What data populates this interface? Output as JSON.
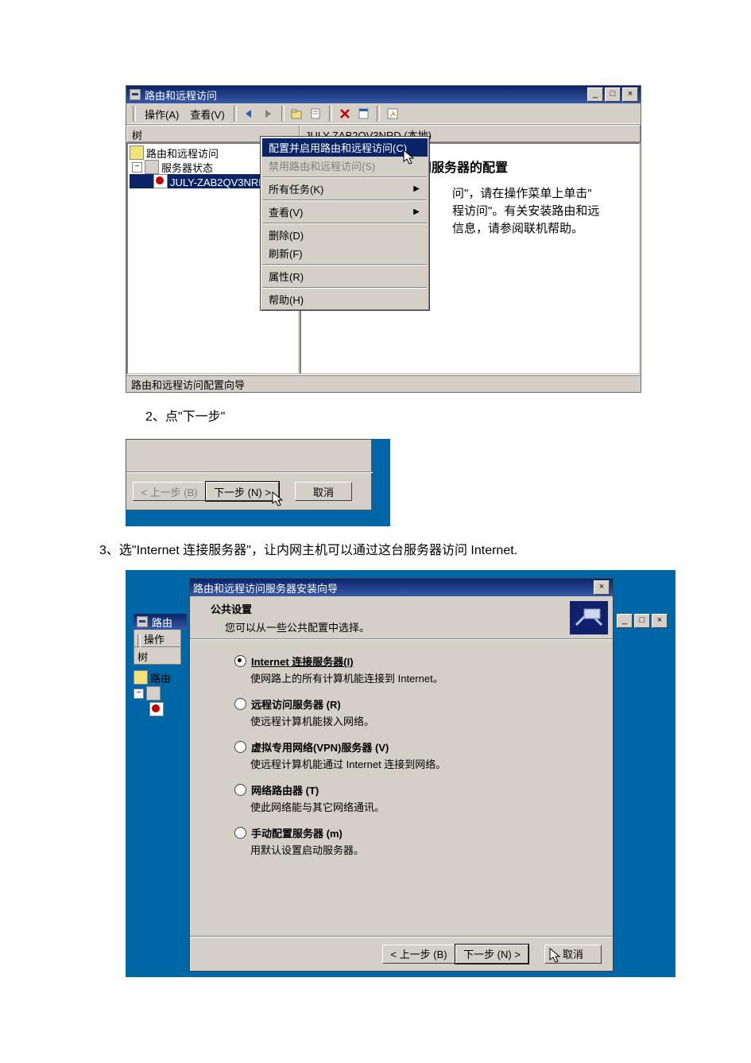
{
  "shot1": {
    "title": "路由和远程访问",
    "menu": {
      "action": "操作(A)",
      "view": "查看(V)"
    },
    "heads": {
      "tree": "树",
      "right": "JULY-ZAB2QV3NRD (本地)"
    },
    "tree": {
      "root": "路由和远程访问",
      "status": "服务器状态",
      "node": "JULY-ZAB2QV3NRD (本"
    },
    "info": {
      "title": "路由和远程访问服务器的配置",
      "l1": "问\"，请在操作菜单上单击\"",
      "l2": "程访问\"。有关安装路由和远",
      "l3": "信息，请参阅联机帮助。"
    },
    "ctx": {
      "configure": "配置并启用路由和远程访问(C)",
      "disable": "禁用路由和远程访问(S)",
      "alltasks": "所有任务(K)",
      "view": "查看(V)",
      "delete": "删除(D)",
      "refresh": "刷新(F)",
      "props": "属性(R)",
      "help": "帮助(H)"
    },
    "status": "路由和远程访问配置向导"
  },
  "step2": "2、点\"下一步\"",
  "shot2": {
    "back": "< 上一步 (B)",
    "next": "下一步 (N) >",
    "cancel": "取消"
  },
  "step3": "3、选\"Internet 连接服务器\"，让内网主机可以通过这台服务器访问 Internet.",
  "shot3": {
    "bg_title": "路由",
    "bg_menu": "操作",
    "bg_tree_head": "树",
    "bg_tree_n1": "路由",
    "wiz_title": "路由和远程访问服务器安装向导",
    "hdr_t1": "公共设置",
    "hdr_t2": "您可以从一些公共配置中选择。",
    "op1_l": "Internet 连接服务器(I)",
    "op1_d": "使网路上的所有计算机能连接到 Internet。",
    "op2_l": "远程访问服务器 (R)",
    "op2_d": "使远程计算机能拨入网络。",
    "op3_l": "虚拟专用网络(VPN)服务器 (V)",
    "op3_d": "使远程计算机能通过 Internet 连接到网络。",
    "op4_l": "网络路由器 (T)",
    "op4_d": "使此网络能与其它网络通讯。",
    "op5_l": "手动配置服务器 (m)",
    "op5_d": "用默认设置启动服务器。",
    "back": "< 上一步 (B)",
    "next": "下一步 (N) >",
    "cancel": "取消"
  }
}
